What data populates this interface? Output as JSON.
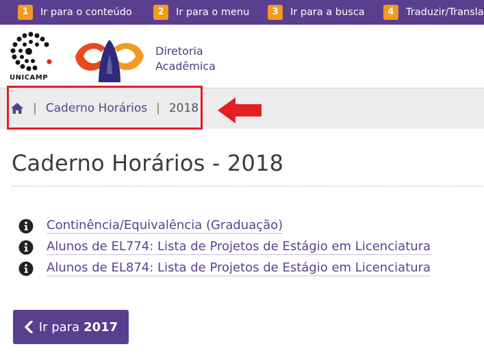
{
  "accessibility_bar": {
    "items": [
      {
        "num": "1",
        "label": "Ir para o conteúdo"
      },
      {
        "num": "2",
        "label": "Ir para o menu"
      },
      {
        "num": "3",
        "label": "Ir para a busca"
      },
      {
        "num": "4",
        "label": "Traduzir/Translate"
      }
    ]
  },
  "header": {
    "unicamp_text": "UNICAMP",
    "dac_line1": "Diretoria",
    "dac_line2": "Acadêmica"
  },
  "breadcrumb": {
    "home_icon": "home-icon",
    "separator": "|",
    "items": [
      "Caderno Horários",
      "2018"
    ]
  },
  "main": {
    "title": "Caderno Horários - 2018",
    "links": [
      {
        "icon": "info-icon",
        "label": "Continência/Equivalência (Graduação)"
      },
      {
        "icon": "info-icon",
        "label": "Alunos de EL774: Lista de Projetos de Estágio em Licenciatura"
      },
      {
        "icon": "info-icon",
        "label": "Alunos de EL874: Lista de Projetos de Estágio em Licenciatura"
      }
    ],
    "prev_button": {
      "prefix": "Ir para",
      "year": "2017"
    }
  },
  "colors": {
    "brand_purple": "#5b3f8f",
    "accent_orange": "#f39a1f",
    "annotation_red": "#e31e24"
  }
}
